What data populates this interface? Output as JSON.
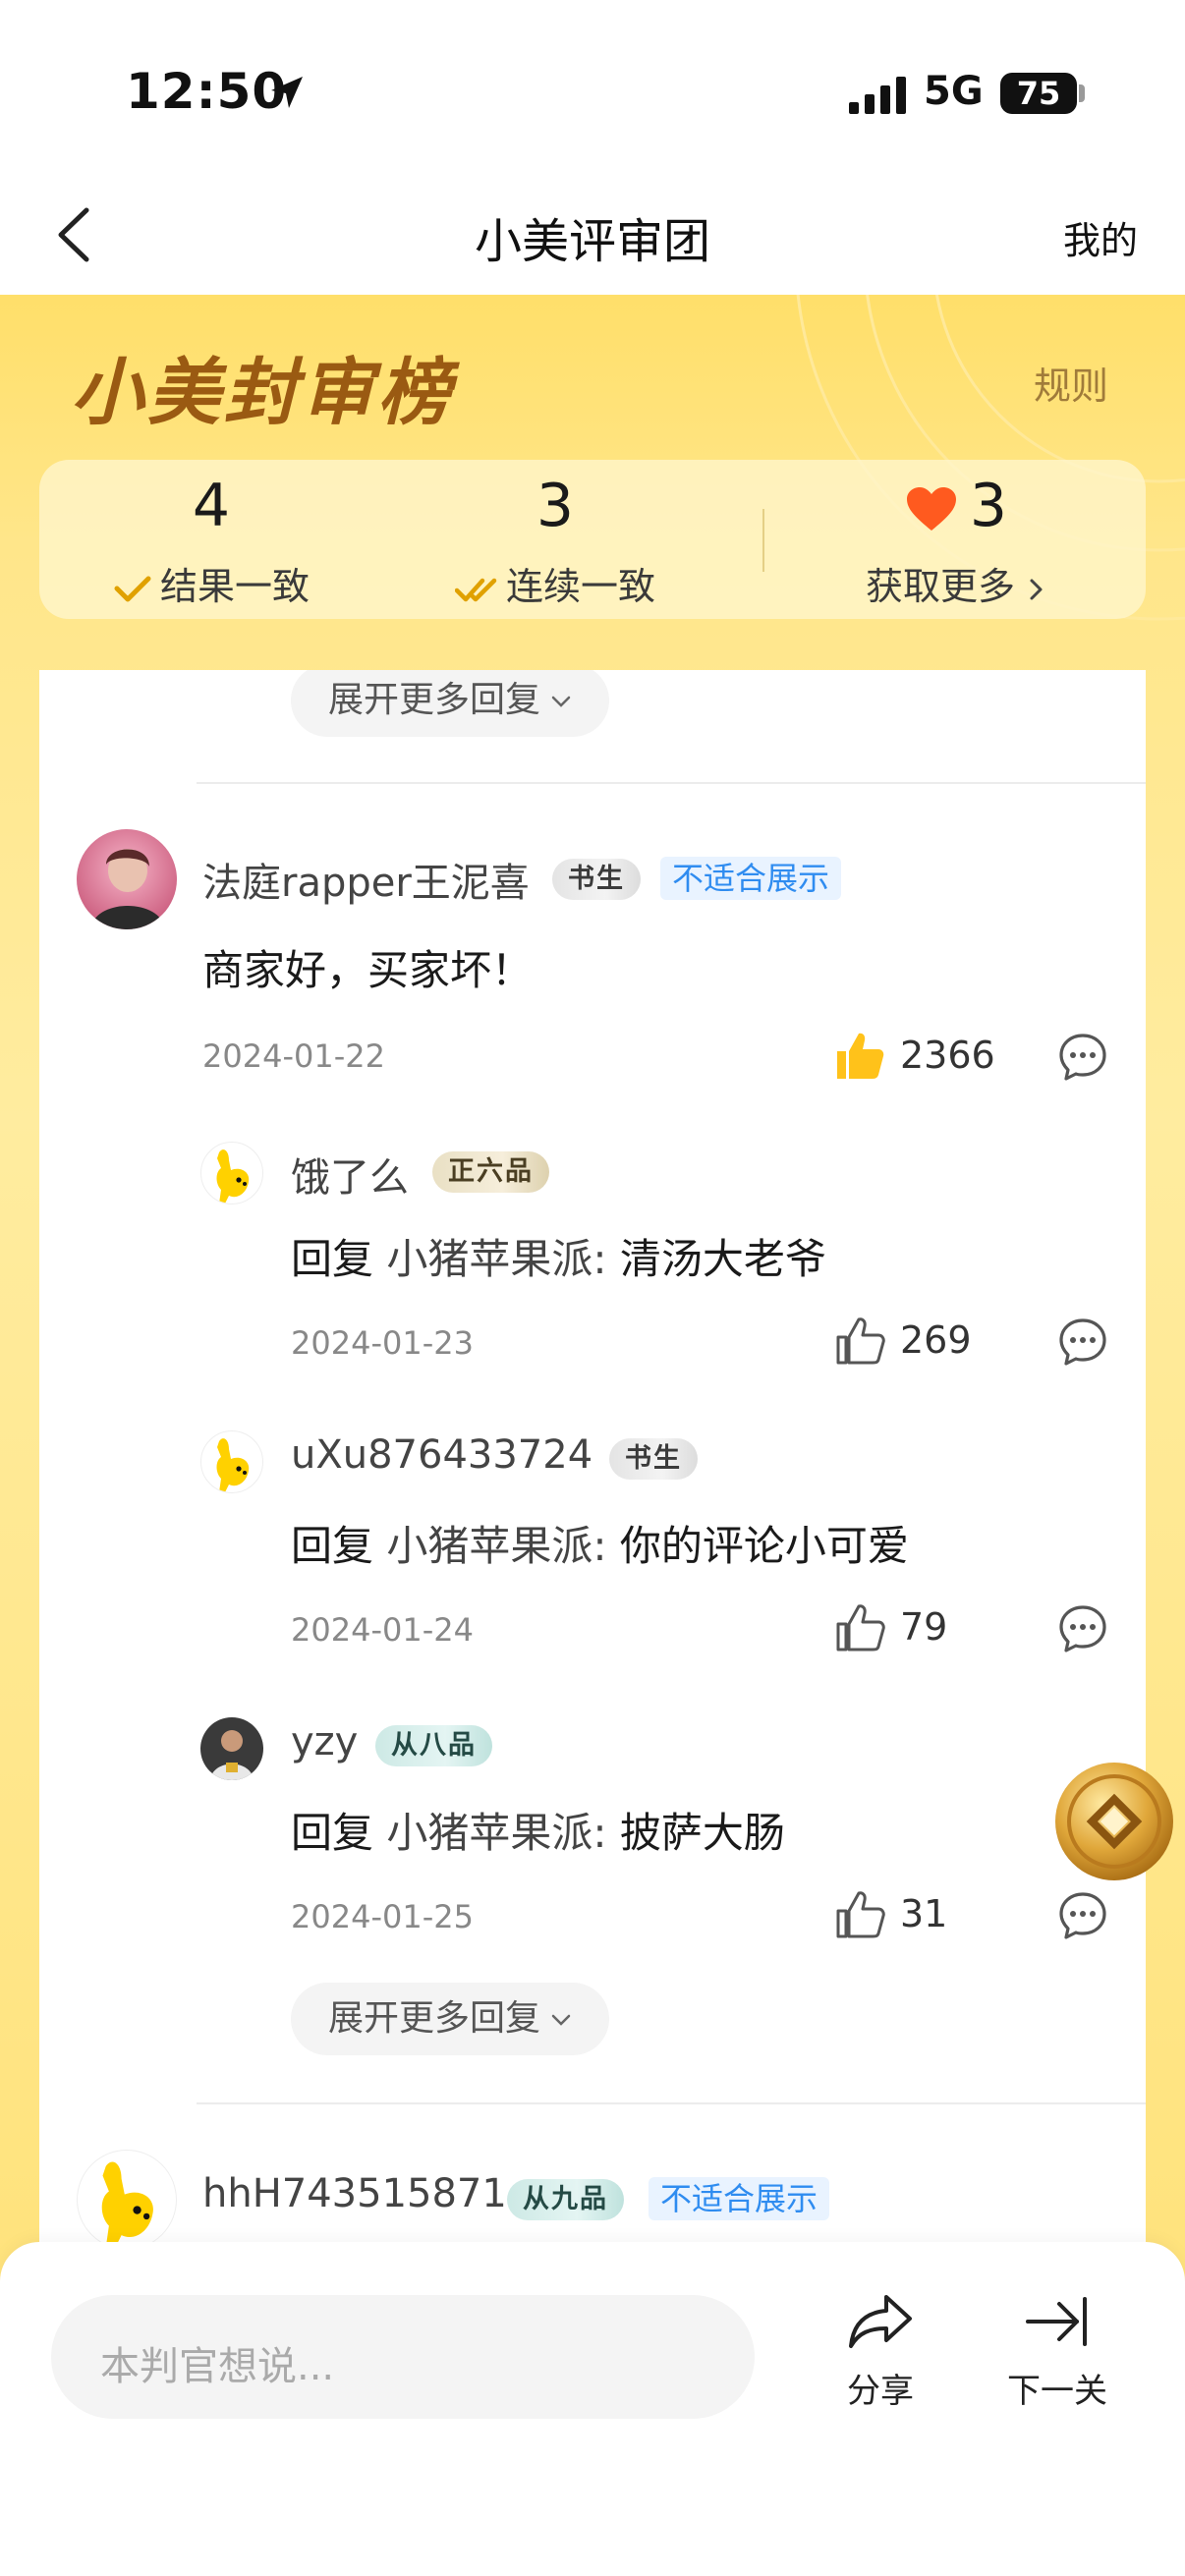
{
  "status_bar": {
    "time": "12:50",
    "network": "5G",
    "battery": "75"
  },
  "nav": {
    "title": "小美评审团",
    "right_link": "我的"
  },
  "header": {
    "brand": "小美封审榜",
    "rules": "规则",
    "stats": [
      {
        "value": "4",
        "label": "结果一致"
      },
      {
        "value": "3",
        "label": "连续一致"
      },
      {
        "value": "3",
        "label": "获取更多"
      }
    ]
  },
  "expand_more": "展开更多回复",
  "comments": [
    {
      "user": "法庭rapper王泥喜",
      "rank": "书生",
      "flag": "不适合展示",
      "text": "商家好，买家坏！",
      "date": "2024-01-22",
      "likes": "2366",
      "replies": [
        {
          "user": "饿了么",
          "rank": "正六品",
          "reply_prefix": "回复",
          "target": "小猪苹果派:",
          "text": "清汤大老爷",
          "date": "2024-01-23",
          "likes": "269"
        },
        {
          "user": "uXu876433724",
          "rank": "书生",
          "reply_prefix": "回复",
          "target": "小猪苹果派:",
          "text": "你的评论小可爱",
          "date": "2024-01-24",
          "likes": "79"
        },
        {
          "user": "yzy",
          "rank": "从八品",
          "reply_prefix": "回复",
          "target": "小猪苹果派:",
          "text": "披萨大肠",
          "date": "2024-01-25",
          "likes": "31"
        }
      ]
    },
    {
      "user": "hhH743515871",
      "rank": "从九品",
      "flag": "不适合展示"
    }
  ],
  "bottom_bar": {
    "input_placeholder": "本判官想说...",
    "share": "分享",
    "next": "下一关"
  },
  "icons": {
    "location": "location-arrow-icon",
    "signal": "cellular-signal-icon",
    "back": "chevron-left-icon",
    "check": "check-icon",
    "double_check": "double-check-icon",
    "heart": "heart-icon",
    "like": "thumbs-up-icon",
    "comment": "comment-bubble-icon",
    "share": "share-arrow-icon",
    "next": "skip-to-end-icon",
    "coin": "gold-coin-icon"
  },
  "colors": {
    "accent_yellow": "#ffe27a",
    "brand_brown": "#9a5a12",
    "heart": "#ff5a1f",
    "like_active": "#ffc21a",
    "flag_blue": "#2f8cf0"
  }
}
